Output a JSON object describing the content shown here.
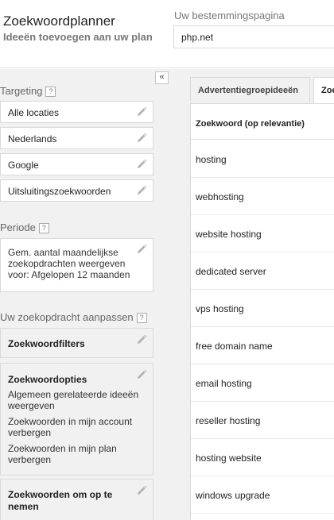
{
  "header": {
    "title": "Zoekwoordplanner",
    "subtitle": "Ideeën toevoegen aan uw plan",
    "destination_label": "Uw bestemmingspagina",
    "destination_value": "php.net"
  },
  "sidebar": {
    "collapse_glyph": "«",
    "targeting": {
      "title": "Targeting",
      "items": [
        "Alle locaties",
        "Nederlands",
        "Google",
        "Uitsluitingszoekwoorden"
      ]
    },
    "period": {
      "title": "Periode",
      "text": "Gem. aantal maandelijkse zoekopdrachten weergeven voor: Afgelopen 12 maanden"
    },
    "customize": {
      "title": "Uw zoekopdracht aanpassen",
      "keyword_filters": "Zoekwoordfilters",
      "keyword_options": {
        "title": "Zoekwoordopties",
        "options": [
          "Algemeen gerelateerde ideeën weergeven",
          "Zoekwoorden in mijn account verbergen",
          "Zoekwoorden in mijn plan verbergen"
        ]
      },
      "include_keywords": "Zoekwoorden om op te nemen"
    },
    "help_glyph": "?"
  },
  "main": {
    "tabs": [
      "Advertentiegroepideeën",
      "Zoe"
    ],
    "table": {
      "column_header": "Zoekwoord (op relevantie)",
      "rows": [
        "hosting",
        "webhosting",
        "website hosting",
        "dedicated server",
        "vps hosting",
        "free domain name",
        "email hosting",
        "reseller hosting",
        "hosting website",
        "windows upgrade"
      ]
    }
  },
  "icons": {
    "edit": "pencil-icon",
    "help": "help-icon",
    "collapse": "double-chevron-left-icon"
  },
  "colors": {
    "sidebar_bg": "#f1f1f1",
    "border": "#d9d9d9",
    "muted_text": "#777777",
    "pencil": "#b3b3b3"
  }
}
